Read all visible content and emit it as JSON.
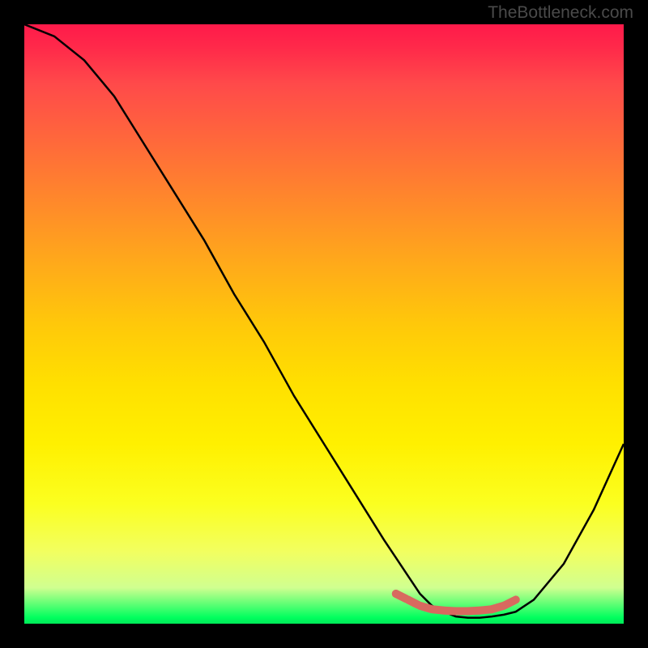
{
  "watermark": "TheBottleneck.com",
  "chart_data": {
    "type": "line",
    "title": "",
    "xlabel": "",
    "ylabel": "",
    "xlim": [
      0,
      100
    ],
    "ylim": [
      0,
      100
    ],
    "series": [
      {
        "name": "curve",
        "x": [
          0,
          5,
          10,
          15,
          20,
          25,
          30,
          35,
          40,
          45,
          50,
          55,
          60,
          62,
          64,
          66,
          68,
          70,
          72,
          74,
          76,
          78,
          80,
          82,
          85,
          90,
          95,
          100
        ],
        "values": [
          100,
          98,
          94,
          88,
          80,
          72,
          64,
          55,
          47,
          38,
          30,
          22,
          14,
          11,
          8,
          5,
          3,
          2,
          1.2,
          1.0,
          1.0,
          1.2,
          1.5,
          2,
          4,
          10,
          19,
          30
        ]
      },
      {
        "name": "marker-band",
        "x": [
          62,
          64,
          66,
          68,
          70,
          72,
          74,
          76,
          78,
          80,
          82
        ],
        "values": [
          5,
          4,
          3,
          2.4,
          2.2,
          2.1,
          2.1,
          2.2,
          2.4,
          3,
          4
        ]
      }
    ],
    "gradient_stops": [
      {
        "pos": 0,
        "color": "#ff1a4a"
      },
      {
        "pos": 10,
        "color": "#ff4a4a"
      },
      {
        "pos": 30,
        "color": "#ff8a2a"
      },
      {
        "pos": 50,
        "color": "#ffc80a"
      },
      {
        "pos": 70,
        "color": "#fff000"
      },
      {
        "pos": 90,
        "color": "#e8ff80"
      },
      {
        "pos": 99,
        "color": "#00ff5e"
      },
      {
        "pos": 100,
        "color": "#00e858"
      }
    ],
    "marker_color": "#d8695f"
  }
}
